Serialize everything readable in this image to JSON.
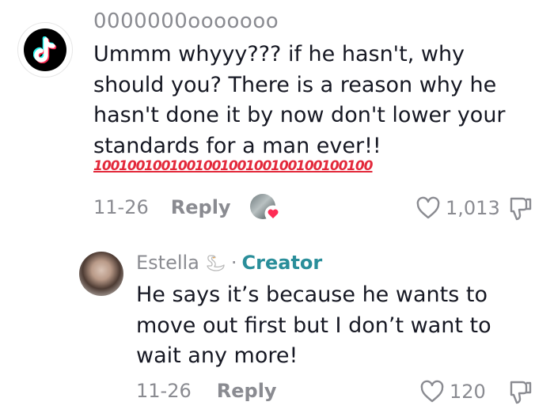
{
  "comment": {
    "username": "0000000ooooooo",
    "body": "Ummm whyyy??? if he hasn't, why should you? There is a reason why he hasn't done it by now don't lower your standards for a man ever!!",
    "emoji_row": [
      "💯",
      "💯",
      "💯",
      "💯",
      "💯",
      "💯",
      "💯",
      "💯",
      "💯",
      "💯",
      "💯"
    ],
    "emoji_glyph": "100",
    "date": "11-26",
    "reply_label": "Reply",
    "like_count": "1,013"
  },
  "reply": {
    "username": "Estella",
    "separator": "·",
    "badge": "Creator",
    "body": "He says it’s because he wants to move out first but I don’t want to wait any more!",
    "date": "11-26",
    "reply_label": "Reply",
    "like_count": "120"
  },
  "colors": {
    "text_primary": "#161823",
    "text_secondary": "#8a8b91",
    "creator": "#2a8e9a",
    "heart_badge": "#fe2c55"
  },
  "icons": {
    "app_logo": "tiktok-logo-icon",
    "swan": "swan-emoji-icon",
    "like": "heart-outline-icon",
    "dislike": "thumbs-down-icon",
    "liked_by_creator": "heart-badge-icon"
  }
}
